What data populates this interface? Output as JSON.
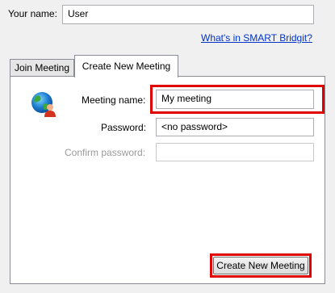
{
  "your_name": {
    "label": "Your name:",
    "value": "User"
  },
  "help_link": "What's in SMART Bridgit?",
  "tabs": [
    {
      "label": "Join Meeting",
      "active": false
    },
    {
      "label": "Create New Meeting",
      "active": true
    }
  ],
  "create": {
    "icon": "globe-person-icon",
    "meeting_name": {
      "label": "Meeting name:",
      "value": "My meeting"
    },
    "password": {
      "label": "Password:",
      "value": "<no password>"
    },
    "confirm_password": {
      "label": "Confirm password:",
      "value": ""
    },
    "create_button": "Create New Meeting"
  },
  "colors": {
    "highlight": "#e00000",
    "link": "#0033cc"
  }
}
